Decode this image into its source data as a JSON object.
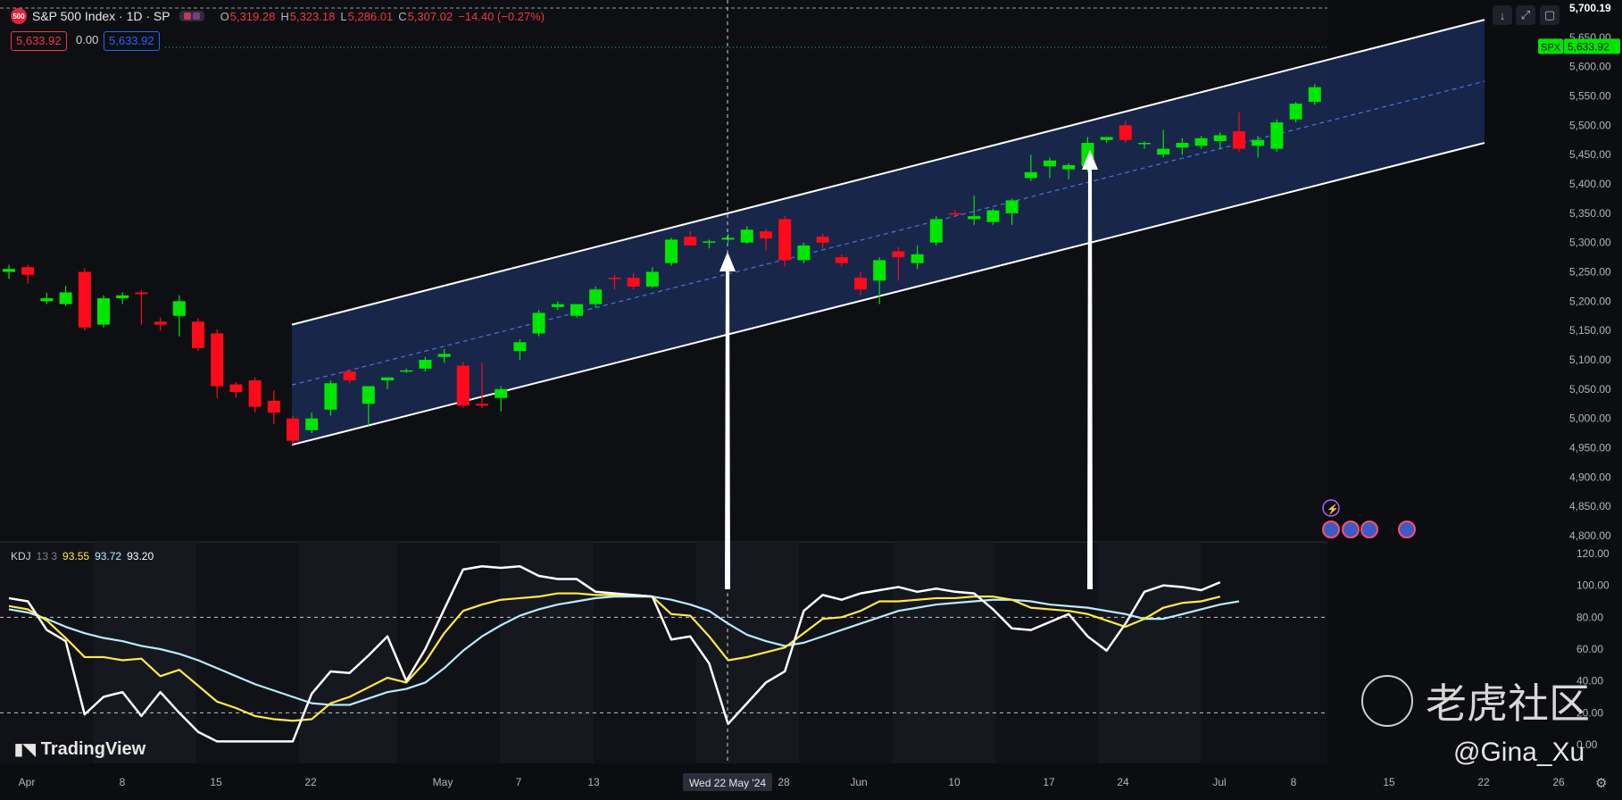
{
  "header": {
    "symbol_icon": "500",
    "title": "S&P 500 Index · 1D · SP",
    "ohlc": [
      {
        "label": "O",
        "value": "5,319.28"
      },
      {
        "label": "H",
        "value": "5,323.18"
      },
      {
        "label": "L",
        "value": "5,286.01"
      },
      {
        "label": "C",
        "value": "5,307.02"
      }
    ],
    "change": "−14.40 (−0.27%)",
    "bid": "5,633.92",
    "spread": "0.00",
    "ask": "5,633.92"
  },
  "price_axis": {
    "top_label": "5,700.19",
    "current_tag": "SPX",
    "current_value": "5,633.92",
    "ticks": [
      "5,650.00",
      "5,600.00",
      "5,550.00",
      "5,500.00",
      "5,450.00",
      "5,400.00",
      "5,350.00",
      "5,300.00",
      "5,250.00",
      "5,200.00",
      "5,150.00",
      "5,100.00",
      "5,050.00",
      "5,000.00",
      "4,950.00",
      "4,900.00",
      "4,850.00",
      "4,800.00"
    ]
  },
  "kdj": {
    "name": "KDJ",
    "params": "13 3",
    "k_value": "93.55",
    "d_value": "93.72",
    "j_value": "93.20",
    "ticks": [
      "120.00",
      "100.00",
      "80.00",
      "60.00",
      "40.00",
      "20.00",
      "0.00"
    ]
  },
  "time_axis": {
    "labels": [
      "Apr",
      "8",
      "15",
      "22",
      "May",
      "7",
      "13",
      "28",
      "Jun",
      "10",
      "17",
      "24",
      "Jul",
      "8",
      "15",
      "22",
      "26"
    ],
    "crosshair_label": "Wed 22 May '24"
  },
  "watermarks": {
    "brand": "TradingView",
    "community": "老虎社区",
    "user": "@Gina_Xu"
  },
  "toolbar": {
    "icons": [
      "arrow-down-icon",
      "fullscreen-icon",
      "screenshot-icon"
    ]
  },
  "colors": {
    "up": "#00e600",
    "down": "#ff0a1a",
    "channel_fill": "#1a2a55",
    "k_line": "#ffe94a",
    "d_line": "#b8ecff",
    "j_line": "#ffffff"
  },
  "chart_data": {
    "type": "candlestick",
    "title": "S&P 500 Index · 1D · SP",
    "xlabel": "",
    "ylabel": "",
    "ylim": [
      4800,
      5700
    ],
    "categories": [
      "2024-04-01",
      "2024-04-02",
      "2024-04-03",
      "2024-04-04",
      "2024-04-05",
      "2024-04-08",
      "2024-04-09",
      "2024-04-10",
      "2024-04-11",
      "2024-04-12",
      "2024-04-15",
      "2024-04-16",
      "2024-04-17",
      "2024-04-18",
      "2024-04-19",
      "2024-04-22",
      "2024-04-23",
      "2024-04-24",
      "2024-04-25",
      "2024-04-26",
      "2024-04-29",
      "2024-04-30",
      "2024-05-01",
      "2024-05-02",
      "2024-05-03",
      "2024-05-06",
      "2024-05-07",
      "2024-05-08",
      "2024-05-09",
      "2024-05-10",
      "2024-05-13",
      "2024-05-14",
      "2024-05-15",
      "2024-05-16",
      "2024-05-17",
      "2024-05-20",
      "2024-05-21",
      "2024-05-22",
      "2024-05-23",
      "2024-05-24",
      "2024-05-28",
      "2024-05-29",
      "2024-05-30",
      "2024-05-31",
      "2024-06-03",
      "2024-06-04",
      "2024-06-05",
      "2024-06-06",
      "2024-06-07",
      "2024-06-10",
      "2024-06-11",
      "2024-06-12",
      "2024-06-13",
      "2024-06-14",
      "2024-06-17",
      "2024-06-18",
      "2024-06-20",
      "2024-06-21",
      "2024-06-24",
      "2024-06-25",
      "2024-06-26",
      "2024-06-27",
      "2024-06-28",
      "2024-07-01",
      "2024-07-02",
      "2024-07-03",
      "2024-07-05",
      "2024-07-08",
      "2024-07-09",
      "2024-07-10"
    ],
    "ohlc": [
      [
        5250,
        5262,
        5238,
        5255
      ],
      [
        5258,
        5262,
        5230,
        5245
      ],
      [
        5200,
        5214,
        5195,
        5205
      ],
      [
        5195,
        5226,
        5192,
        5215
      ],
      [
        5250,
        5256,
        5150,
        5155
      ],
      [
        5160,
        5210,
        5155,
        5205
      ],
      [
        5205,
        5215,
        5195,
        5210
      ],
      [
        5215,
        5219,
        5160,
        5212
      ],
      [
        5165,
        5172,
        5150,
        5160
      ],
      [
        5175,
        5210,
        5140,
        5200
      ],
      [
        5165,
        5171,
        5115,
        5120
      ],
      [
        5145,
        5152,
        5035,
        5055
      ],
      [
        5058,
        5062,
        5035,
        5045
      ],
      [
        5065,
        5070,
        5010,
        5020
      ],
      [
        5030,
        5048,
        4990,
        5010
      ],
      [
        5000,
        5005,
        4955,
        4962
      ],
      [
        4980,
        5010,
        4975,
        5000
      ],
      [
        5015,
        5065,
        5005,
        5060
      ],
      [
        5080,
        5082,
        5060,
        5065
      ],
      [
        5025,
        5055,
        4988,
        5055
      ],
      [
        5065,
        5070,
        5050,
        5070
      ],
      [
        5080,
        5085,
        5078,
        5082
      ],
      [
        5085,
        5105,
        5080,
        5100
      ],
      [
        5105,
        5118,
        5095,
        5110
      ],
      [
        5090,
        5097,
        5018,
        5022
      ],
      [
        5025,
        5095,
        5018,
        5022
      ],
      [
        5035,
        5055,
        5012,
        5050
      ],
      [
        5115,
        5135,
        5100,
        5130
      ],
      [
        5145,
        5185,
        5140,
        5180
      ],
      [
        5190,
        5200,
        5185,
        5195
      ],
      [
        5175,
        5195,
        5172,
        5195
      ],
      [
        5195,
        5225,
        5190,
        5220
      ],
      [
        5240,
        5245,
        5220,
        5238
      ],
      [
        5240,
        5248,
        5220,
        5225
      ],
      [
        5225,
        5258,
        5222,
        5250
      ],
      [
        5265,
        5308,
        5260,
        5305
      ],
      [
        5310,
        5320,
        5300,
        5295
      ],
      [
        5300,
        5305,
        5290,
        5302
      ],
      [
        5305,
        5315,
        5300,
        5308
      ],
      [
        5300,
        5328,
        5298,
        5322
      ],
      [
        5319,
        5323,
        5286,
        5307
      ],
      [
        5340,
        5345,
        5260,
        5270
      ],
      [
        5270,
        5300,
        5265,
        5295
      ],
      [
        5310,
        5315,
        5290,
        5300
      ],
      [
        5275,
        5280,
        5260,
        5265
      ],
      [
        5240,
        5250,
        5210,
        5220
      ],
      [
        5235,
        5275,
        5195,
        5270
      ],
      [
        5285,
        5292,
        5235,
        5275
      ],
      [
        5265,
        5295,
        5255,
        5280
      ],
      [
        5300,
        5345,
        5295,
        5340
      ],
      [
        5350,
        5356,
        5345,
        5348
      ],
      [
        5340,
        5380,
        5330,
        5345
      ],
      [
        5335,
        5358,
        5330,
        5355
      ],
      [
        5350,
        5375,
        5330,
        5372
      ],
      [
        5410,
        5450,
        5405,
        5420
      ],
      [
        5430,
        5445,
        5410,
        5440
      ],
      [
        5425,
        5435,
        5408,
        5432
      ],
      [
        5430,
        5480,
        5420,
        5470
      ],
      [
        5475,
        5480,
        5470,
        5480
      ],
      [
        5500,
        5508,
        5470,
        5475
      ],
      [
        5468,
        5473,
        5460,
        5470
      ],
      [
        5450,
        5492,
        5445,
        5460
      ],
      [
        5462,
        5478,
        5450,
        5470
      ],
      [
        5465,
        5482,
        5460,
        5478
      ],
      [
        5473,
        5488,
        5460,
        5483
      ],
      [
        5490,
        5522,
        5455,
        5460
      ],
      [
        5465,
        5482,
        5445,
        5475
      ],
      [
        5460,
        5510,
        5455,
        5505
      ],
      [
        5510,
        5540,
        5505,
        5537
      ],
      [
        5540,
        5570,
        5535,
        5565
      ]
    ],
    "kdj": {
      "k": [
        87,
        85,
        78,
        67,
        55,
        55,
        53,
        54,
        43,
        47,
        37,
        27,
        23,
        18,
        16,
        15,
        16,
        26,
        30,
        36,
        42,
        39,
        52,
        70,
        84,
        88,
        91,
        92,
        93,
        95,
        95,
        94,
        94,
        94,
        93,
        82,
        81,
        68,
        53,
        55,
        58,
        61,
        70,
        79,
        80,
        84,
        90,
        90,
        91,
        92,
        92,
        93,
        93,
        91,
        86,
        85,
        84,
        82,
        78,
        74,
        79,
        86,
        89,
        90,
        93
      ],
      "d": [
        85,
        83,
        79,
        74,
        70,
        67,
        65,
        62,
        60,
        57,
        53,
        48,
        43,
        38,
        34,
        30,
        26,
        25,
        25,
        29,
        33,
        35,
        39,
        48,
        59,
        68,
        75,
        81,
        85,
        88,
        90,
        92,
        93,
        93,
        93,
        91,
        88,
        84,
        76,
        69,
        65,
        62,
        64,
        68,
        72,
        76,
        80,
        84,
        86,
        88,
        89,
        90,
        91,
        91,
        90,
        88,
        87,
        86,
        84,
        82,
        79,
        79,
        82,
        85,
        88,
        90
      ],
      "j": [
        92,
        90,
        72,
        65,
        19,
        30,
        33,
        18,
        33,
        20,
        8,
        2,
        2,
        2,
        2,
        2,
        32,
        46,
        45,
        56,
        68,
        40,
        60,
        85,
        110,
        112,
        111,
        112,
        106,
        104,
        104,
        96,
        95,
        94,
        93,
        66,
        68,
        51,
        13,
        26,
        39,
        46,
        84,
        94,
        91,
        95,
        97,
        99,
        96,
        98,
        96,
        95,
        85,
        73,
        72,
        77,
        82,
        68,
        59,
        76,
        96,
        100,
        99,
        97,
        102
      ]
    }
  }
}
